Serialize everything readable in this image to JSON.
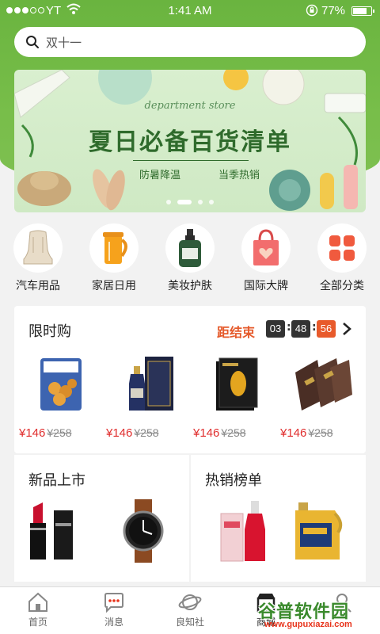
{
  "status_bar": {
    "carrier": "YT",
    "time": "1:41 AM",
    "battery": "77%",
    "battery_level": 0.77
  },
  "search": {
    "placeholder": "双十一"
  },
  "banner": {
    "script": "department store",
    "headline": "夏日必备百货清单",
    "tag_left": "防暑降温",
    "tag_right": "当季热销",
    "slide_count": 4,
    "active_slide": 2
  },
  "categories": [
    {
      "label": "汽车用品",
      "icon": "car-seat-icon"
    },
    {
      "label": "家居日用",
      "icon": "kettle-icon"
    },
    {
      "label": "美妆护肤",
      "icon": "cosmetics-bottle-icon"
    },
    {
      "label": "国际大牌",
      "icon": "shopping-bag-icon"
    },
    {
      "label": "全部分类",
      "icon": "grid-icon"
    }
  ],
  "flash_sale": {
    "title": "限时购",
    "ends_label": "距结束",
    "hours": "03",
    "minutes": "48",
    "seconds": "56",
    "products": [
      {
        "price": "¥146",
        "old_price": "¥258",
        "icon": "snack-package-icon"
      },
      {
        "price": "¥146",
        "old_price": "¥258",
        "icon": "liquor-bottle-icon"
      },
      {
        "price": "¥146",
        "old_price": "¥258",
        "icon": "face-mask-box-icon"
      },
      {
        "price": "¥146",
        "old_price": "¥258",
        "icon": "chocolate-box-icon"
      }
    ]
  },
  "panels": {
    "new_arrivals": "新品上市",
    "best_sellers": "热销榜单"
  },
  "tab_bar": [
    {
      "label": "首页",
      "icon": "home-icon"
    },
    {
      "label": "消息",
      "icon": "message-icon"
    },
    {
      "label": "良知社",
      "icon": "planet-icon"
    },
    {
      "label": "商城",
      "icon": "store-icon"
    },
    {
      "label": "",
      "icon": "profile-icon"
    }
  ],
  "watermark": {
    "text": "谷普软件园",
    "url": "www.gupuxiazai.com"
  },
  "colors": {
    "brand_green": "#6ab43f",
    "price_red": "#e02e2e",
    "countdown_orange": "#e85a2b"
  }
}
